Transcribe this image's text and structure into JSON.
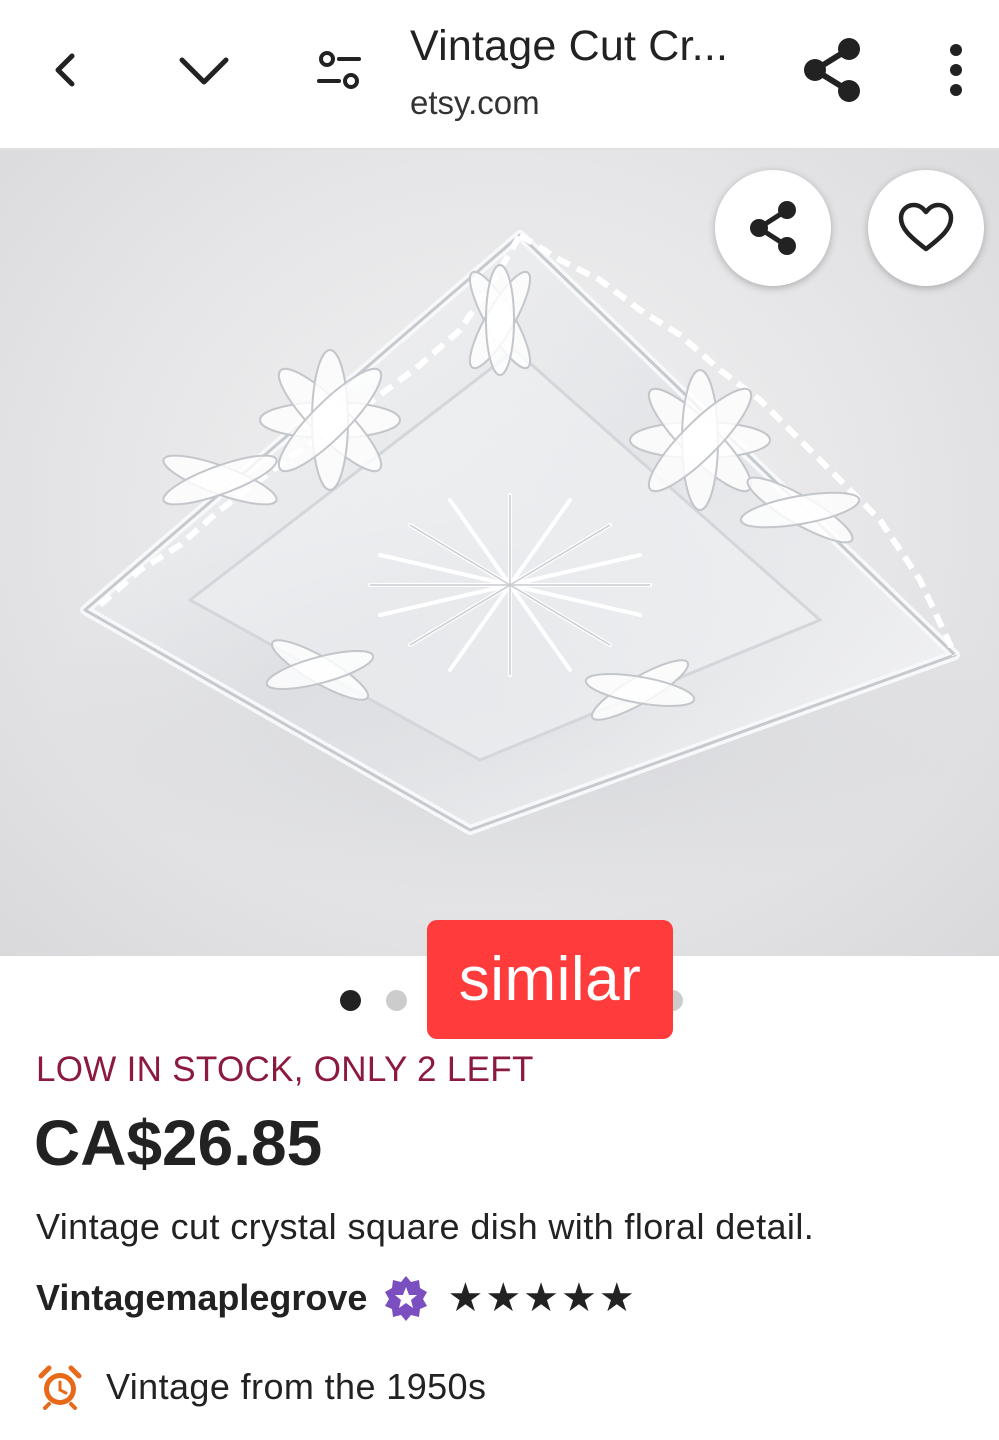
{
  "browser_bar": {
    "title": "Vintage Cut Cr...",
    "domain": "etsy.com",
    "icons": [
      "back-arrow-icon",
      "chevron-down-icon",
      "tune-icon",
      "share-icon",
      "more-vert-icon"
    ]
  },
  "product_image": {
    "alt": "Vintage cut crystal square dish",
    "overlay_buttons": [
      "share-icon",
      "heart-icon"
    ],
    "carousel_dots": 3,
    "active_dot": 1,
    "similar_label": "similar"
  },
  "listing": {
    "stock_notice": "LOW IN STOCK, ONLY 2 LEFT",
    "price": "CA$26.85",
    "description": "Vintage cut crystal square dish with floral detail.",
    "shop_name": "Vintagemaplegrove",
    "rating": 5,
    "rating_stars": [
      "★",
      "★",
      "★",
      "★",
      "★"
    ],
    "vintage_note": "Vintage from the 1950s"
  },
  "colors": {
    "stock_text": "#8b1a3e",
    "similar_badge": "#ff3b3b",
    "star_seller": "#7b4fc0",
    "vintage_icon": "#e8691a"
  }
}
